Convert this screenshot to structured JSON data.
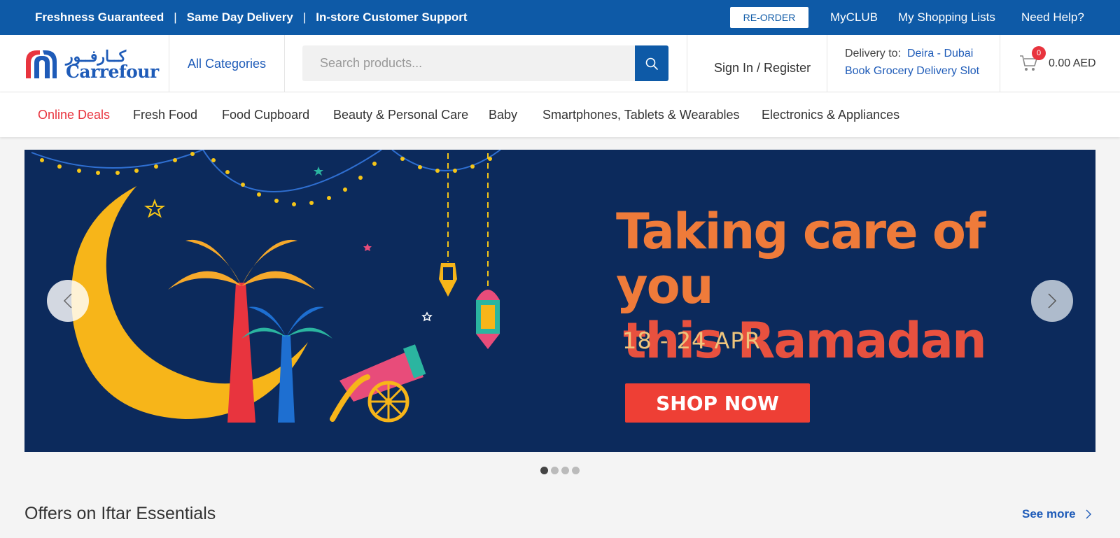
{
  "topbar": {
    "promos": [
      "Freshness Guaranteed",
      "Same Day Delivery",
      "In-store Customer Support"
    ],
    "separator": "|",
    "reorder_label": "RE-ORDER",
    "myclub_label": "MyCLUB",
    "shopping_lists_label": "My Shopping Lists",
    "help_label": "Need Help?"
  },
  "header": {
    "logo_ar": "كــارفــور",
    "logo_en": "Carrefour",
    "all_categories_label": "All Categories",
    "search_placeholder": "Search products...",
    "signin_label": "Sign In / Register",
    "delivery_label": "Delivery to:",
    "delivery_location": "Deira - Dubai",
    "delivery_slot_label": "Book Grocery Delivery Slot",
    "cart_count": "0",
    "cart_total": "0.00 AED"
  },
  "catnav": {
    "items": [
      "Online Deals",
      "Fresh Food",
      "Food Cupboard",
      "Beauty & Personal Care",
      "Baby",
      "Smartphones, Tablets & Wearables",
      "Electronics & Appliances"
    ]
  },
  "banner": {
    "headline_line1": "Taking care of you",
    "headline_line2": "this Ramadan",
    "dates": "18 - 24 APR",
    "cta_label": "SHOP NOW",
    "slide_count": 4,
    "active_slide": 1
  },
  "section": {
    "title": "Offers on Iftar Essentials",
    "see_more_label": "See more"
  },
  "colors": {
    "brand_blue": "#0e5aa7",
    "deal_red": "#e8343e",
    "banner_bg": "#0c2a5c",
    "headline_orange": "#ef7b3a"
  }
}
